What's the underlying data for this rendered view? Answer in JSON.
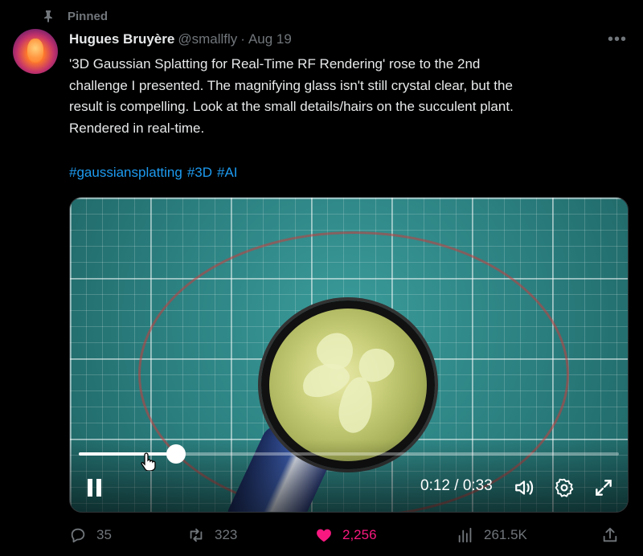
{
  "pinned": {
    "label": "Pinned"
  },
  "author": {
    "name": "Hugues Bruyère",
    "handle": "@smallfly",
    "separator": "·",
    "date": "Aug 19"
  },
  "tweet": {
    "lines": [
      "'3D Gaussian Splatting for Real-Time RF Rendering' rose to the 2nd",
      "challenge I presented. The magnifying glass isn't still crystal clear, but the",
      "result is compelling. Look at the small details/hairs on the succulent plant.",
      "Rendered in real-time."
    ],
    "hashtags": [
      "#gaussiansplatting",
      "#3D",
      "#AI"
    ]
  },
  "video": {
    "time_display": "0:12 / 0:33",
    "progress_fraction": 0.18,
    "playing": true
  },
  "actions": {
    "replies": "35",
    "reposts": "323",
    "likes": "2,256",
    "views": "261.5K",
    "liked": true
  },
  "colors": {
    "accent": "#1d9bf0",
    "like": "#f91880",
    "muted": "#71767b",
    "background": "#000000"
  },
  "icons": [
    "pin-icon",
    "more-icon",
    "pause-icon",
    "volume-icon",
    "gear-icon",
    "fullscreen-icon",
    "reply-icon",
    "repost-icon",
    "heart-icon",
    "views-icon",
    "share-icon"
  ]
}
